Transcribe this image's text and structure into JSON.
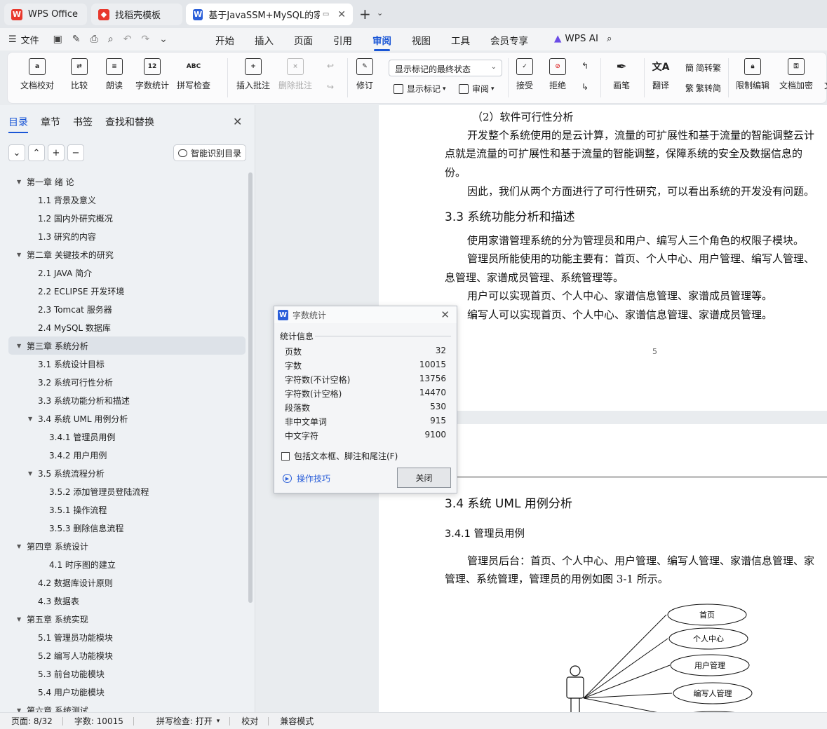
{
  "tabs": [
    {
      "label": "WPS Office",
      "icon": "wps-logo-icon",
      "color": "#e8382d"
    },
    {
      "label": "找稻壳模板",
      "icon": "docer-icon",
      "color": "#e8382d"
    },
    {
      "label": "基于JavaSSM+MySQL的家谱",
      "icon": "word-doc-icon",
      "color": "#2b5fd9"
    }
  ],
  "menu": {
    "file": "文件",
    "items": [
      "开始",
      "插入",
      "页面",
      "引用",
      "审阅",
      "视图",
      "工具",
      "会员专享"
    ],
    "active": "审阅",
    "wps_ai": "WPS AI"
  },
  "ribbon": {
    "doc_check": "文档校对",
    "compare": "比较",
    "read_aloud": "朗读",
    "word_count": "字数统计",
    "word_count_icon_text": "12",
    "spell_check": "拼写检查",
    "spell_icon_text": "ABC",
    "insert_comment": "插入批注",
    "delete_comment": "删除批注",
    "track_changes": "修订",
    "markup_combo": "显示标记的最终状态",
    "show_markup": "显示标记",
    "review": "审阅",
    "accept": "接受",
    "reject": "拒绝",
    "ink": "画笔",
    "translate": "翻译",
    "to_traditional": "简转繁",
    "to_simplified": "繁转简",
    "restrict_edit": "限制编辑",
    "encrypt": "文档加密",
    "more": "文"
  },
  "nav": {
    "tabs": [
      "目录",
      "章节",
      "书签",
      "查找和替换"
    ],
    "active_tab": "目录",
    "smart_toc": "智能识别目录",
    "btn_down": "⌄",
    "btn_up": "⌃",
    "btn_add": "+",
    "btn_remove": "−",
    "toc": [
      {
        "text": "第一章  绪  论",
        "level": 1,
        "expanded": true
      },
      {
        "text": "1.1 背景及意义",
        "level": 2
      },
      {
        "text": "1.2 国内外研究概况",
        "level": 2
      },
      {
        "text": "1.3  研究的内容",
        "level": 2
      },
      {
        "text": "第二章  关键技术的研究",
        "level": 1,
        "expanded": true
      },
      {
        "text": "2.1 JAVA 简介",
        "level": 2
      },
      {
        "text": "2.2 ECLIPSE  开发环境",
        "level": 2
      },
      {
        "text": "2.3 Tomcat 服务器",
        "level": 2
      },
      {
        "text": "2.4 MySQL 数据库",
        "level": 2
      },
      {
        "text": "第三章  系统分析",
        "level": 1,
        "expanded": true,
        "selected": true
      },
      {
        "text": "3.1  系统设计目标",
        "level": 2
      },
      {
        "text": "3.2  系统可行性分析",
        "level": 2
      },
      {
        "text": "3.3  系统功能分析和描述",
        "level": 2
      },
      {
        "text": "3.4 系统 UML 用例分析",
        "level": 2,
        "expanded": true
      },
      {
        "text": "3.4.1 管理员用例",
        "level": 3
      },
      {
        "text": "3.4.2 用户用例",
        "level": 3
      },
      {
        "text": "3.5 系统流程分析",
        "level": 2,
        "expanded": true
      },
      {
        "text": "3.5.2 添加管理员登陆流程",
        "level": 3
      },
      {
        "text": "3.5.1 操作流程",
        "level": 3
      },
      {
        "text": "3.5.3 删除信息流程",
        "level": 3
      },
      {
        "text": "第四章  系统设计",
        "level": 1,
        "expanded": true
      },
      {
        "text": "4.1  时序图的建立",
        "level": 3
      },
      {
        "text": "4.2  数据库设计原则",
        "level": 2
      },
      {
        "text": "4.3  数据表",
        "level": 2
      },
      {
        "text": "第五章  系统实现",
        "level": 1,
        "expanded": true
      },
      {
        "text": "5.1 管理员功能模块",
        "level": 2
      },
      {
        "text": "5.2 编写人功能模块",
        "level": 2
      },
      {
        "text": "5.3 前台功能模块",
        "level": 2
      },
      {
        "text": "5.4 用户功能模块",
        "level": 2
      },
      {
        "text": "第六章  系统测试",
        "level": 1,
        "expanded": true
      }
    ]
  },
  "document": {
    "page1": {
      "sub_heading": "（2）软件可行性分析",
      "p1_l1": "开发整个系统使用的是云计算，流量的可扩展性和基于流量的智能调整云计",
      "p1_l2": "点就是流量的可扩展性和基于流量的智能调整，保障系统的安全及数据信息的",
      "p1_l3": "份。",
      "p2": "因此，我们从两个方面进行了可行性研究，可以看出系统的开发没有问题。",
      "heading": "3.3  系统功能分析和描述",
      "p3": "使用家谱管理系统的分为管理员和用户、编写人三个角色的权限子模块。",
      "p4_l1": "管理员所能使用的功能主要有：首页、个人中心、用户管理、编写人管理、",
      "p4_l2": "息管理、家谱成员管理、系统管理等。",
      "p5": "用户可以实现首页、个人中心、家谱信息管理、家谱成员管理等。",
      "p6": "编写人可以实现首页、个人中心、家谱信息管理、家谱成员管理。",
      "page_number": "5"
    },
    "page2": {
      "heading": "3.4 系统 UML 用例分析",
      "sub_heading": "3.4.1 管理员用例",
      "p1_l1": "管理员后台：首页、个人中心、用户管理、编写人管理、家谱信息管理、家",
      "p1_l2": "管理、系统管理，管理员的用例如图 3-1 所示。",
      "usecases": [
        "首页",
        "个人中心",
        "用户管理",
        "编写人管理"
      ]
    }
  },
  "dialog": {
    "title": "字数统计",
    "section": "统计信息",
    "stats": [
      {
        "label": "页数",
        "value": "32"
      },
      {
        "label": "字数",
        "value": "10015"
      },
      {
        "label": "字符数(不计空格)",
        "value": "13756"
      },
      {
        "label": "字符数(计空格)",
        "value": "14470"
      },
      {
        "label": "段落数",
        "value": "530"
      },
      {
        "label": "非中文单词",
        "value": "915"
      },
      {
        "label": "中文字符",
        "value": "9100"
      }
    ],
    "checkbox": "包括文本框、脚注和尾注(F)",
    "tips": "操作技巧",
    "close": "关闭"
  },
  "status": {
    "page": "页面: 8/32",
    "words": "字数: 10015",
    "spell": "拼写检查: 打开",
    "proof": "校对",
    "compat": "兼容模式"
  },
  "colors": {
    "accent": "#1a56d6",
    "wps_red": "#e8382d"
  }
}
